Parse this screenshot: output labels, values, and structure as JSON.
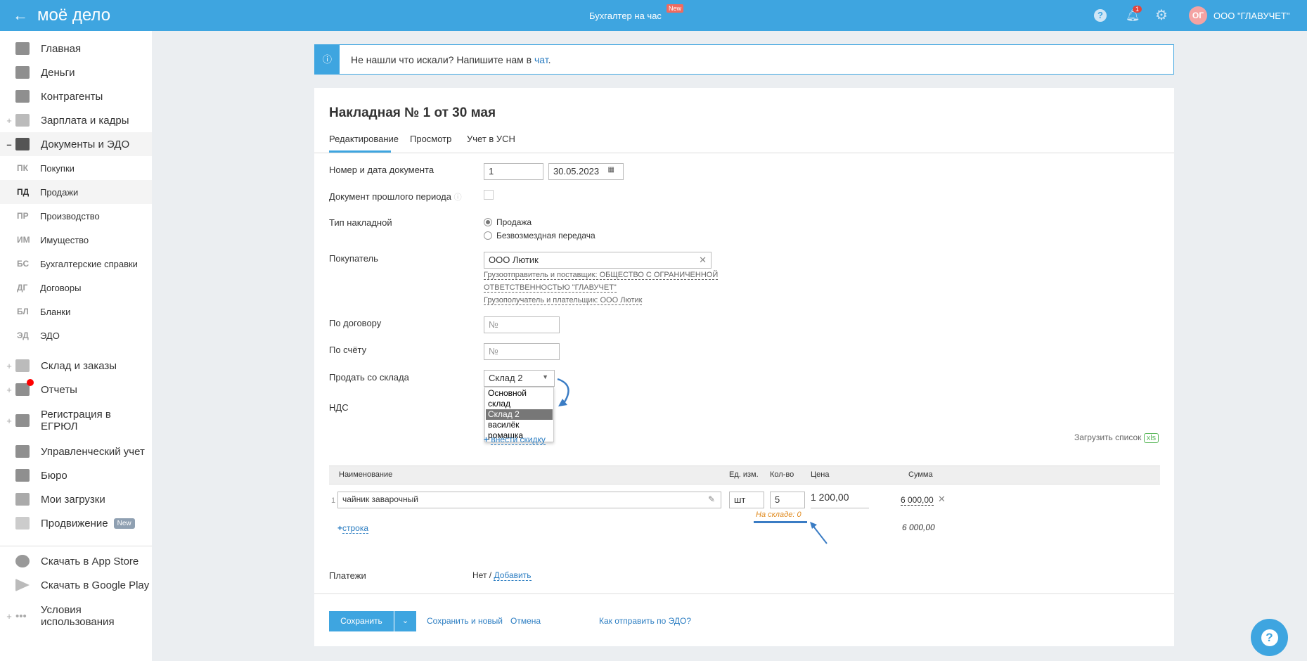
{
  "header": {
    "logo": "моё дело",
    "center_title": "Бухгалтер на час",
    "center_badge": "New",
    "notif_count": "1",
    "avatar_initials": "ОГ",
    "company": "ООО \"ГЛАВУЧЕТ\""
  },
  "sidebar": {
    "items": [
      {
        "label": "Главная",
        "icon": "home-icon",
        "plus": ""
      },
      {
        "label": "Деньги",
        "icon": "money-icon",
        "plus": ""
      },
      {
        "label": "Контрагенты",
        "icon": "contractors-icon",
        "plus": ""
      },
      {
        "label": "Зарплата и кадры",
        "icon": "salary-icon",
        "plus": "+"
      },
      {
        "label": "Документы и ЭДО",
        "icon": "folder-icon",
        "plus": "–"
      }
    ],
    "subitems": [
      {
        "abbr": "ПК",
        "label": "Покупки"
      },
      {
        "abbr": "ПД",
        "label": "Продажи"
      },
      {
        "abbr": "ПР",
        "label": "Производство"
      },
      {
        "abbr": "ИМ",
        "label": "Имущество"
      },
      {
        "abbr": "БС",
        "label": "Бухгалтерские справки"
      },
      {
        "abbr": "ДГ",
        "label": "Договоры"
      },
      {
        "abbr": "БЛ",
        "label": "Бланки"
      },
      {
        "abbr": "ЭД",
        "label": "ЭДО"
      }
    ],
    "items2": [
      {
        "label": "Склад и заказы",
        "icon": "warehouse-icon",
        "plus": "+"
      },
      {
        "label": "Отчеты",
        "icon": "reports-icon",
        "plus": "+"
      },
      {
        "label": "Регистрация в ЕГРЮЛ",
        "icon": "registration-icon",
        "plus": "+"
      },
      {
        "label": "Управленческий учет",
        "icon": "management-icon",
        "plus": ""
      },
      {
        "label": "Бюро",
        "icon": "briefcase-icon",
        "plus": ""
      },
      {
        "label": "Мои загрузки",
        "icon": "downloads-folder-icon",
        "plus": ""
      },
      {
        "label": "Продвижение",
        "icon": "promotion-icon",
        "plus": ""
      }
    ],
    "promo_badge": "New",
    "items3": [
      {
        "label": "Скачать в App Store",
        "icon": "apple-icon",
        "plus": ""
      },
      {
        "label": "Скачать в Google Play",
        "icon": "google-play-icon",
        "plus": ""
      },
      {
        "label": "Условия использования",
        "icon": "more-icon",
        "plus": "+"
      }
    ]
  },
  "banner": {
    "text": "Не нашли что искали? Напишите нам в ",
    "link": "чат",
    "end": "."
  },
  "doc": {
    "title": "Накладная № 1 от 30 мая",
    "tabs": [
      "Редактирование",
      "Просмотр",
      "Учет в УСН"
    ],
    "labels": {
      "number_date": "Номер и дата документа",
      "past_period": "Документ прошлого периода",
      "type": "Тип накладной",
      "buyer": "Покупатель",
      "contract": "По договору",
      "invoice": "По счёту",
      "warehouse": "Продать со склада",
      "vat": "НДС",
      "payments": "Платежи"
    },
    "number": "1",
    "date": "30.05.2023",
    "type_options": [
      "Продажа",
      "Безвозмездная передача"
    ],
    "buyer": "ООО Лютик",
    "shipper": "Грузоотправитель и поставщик: ОБЩЕСТВО С ОГРАНИЧЕННОЙ",
    "shipper2": "ОТВЕТСТВЕННОСТЬЮ \"ГЛАВУЧЕТ\"",
    "consignee": "Грузополучатель и плательщик: ООО Лютик",
    "no_placeholder": "№",
    "warehouse": "Склад 2",
    "warehouse_options": [
      "Основной склад",
      "Склад 2",
      "василёк",
      "ромашка"
    ],
    "discount": "внести скидку",
    "upload_list": "Загрузить список",
    "xls": "xls",
    "table": {
      "headers": [
        "Наименование",
        "Ед. изм.",
        "Кол-во",
        "Цена",
        "Сумма"
      ],
      "rows": [
        {
          "n": "1",
          "name": "чайник заварочный",
          "unit": "шт",
          "qty": "5",
          "price": "1 200,00",
          "sum": "6 000,00",
          "stock": "На складе: 0"
        }
      ],
      "add_row": "строка",
      "total": "6 000,00"
    },
    "payments_none": "Нет /",
    "payments_add": "Добавить"
  },
  "footer": {
    "save": "Сохранить",
    "save_new": "Сохранить и новый",
    "cancel": "Отмена",
    "edo": "Как отправить по ЭДО?"
  }
}
